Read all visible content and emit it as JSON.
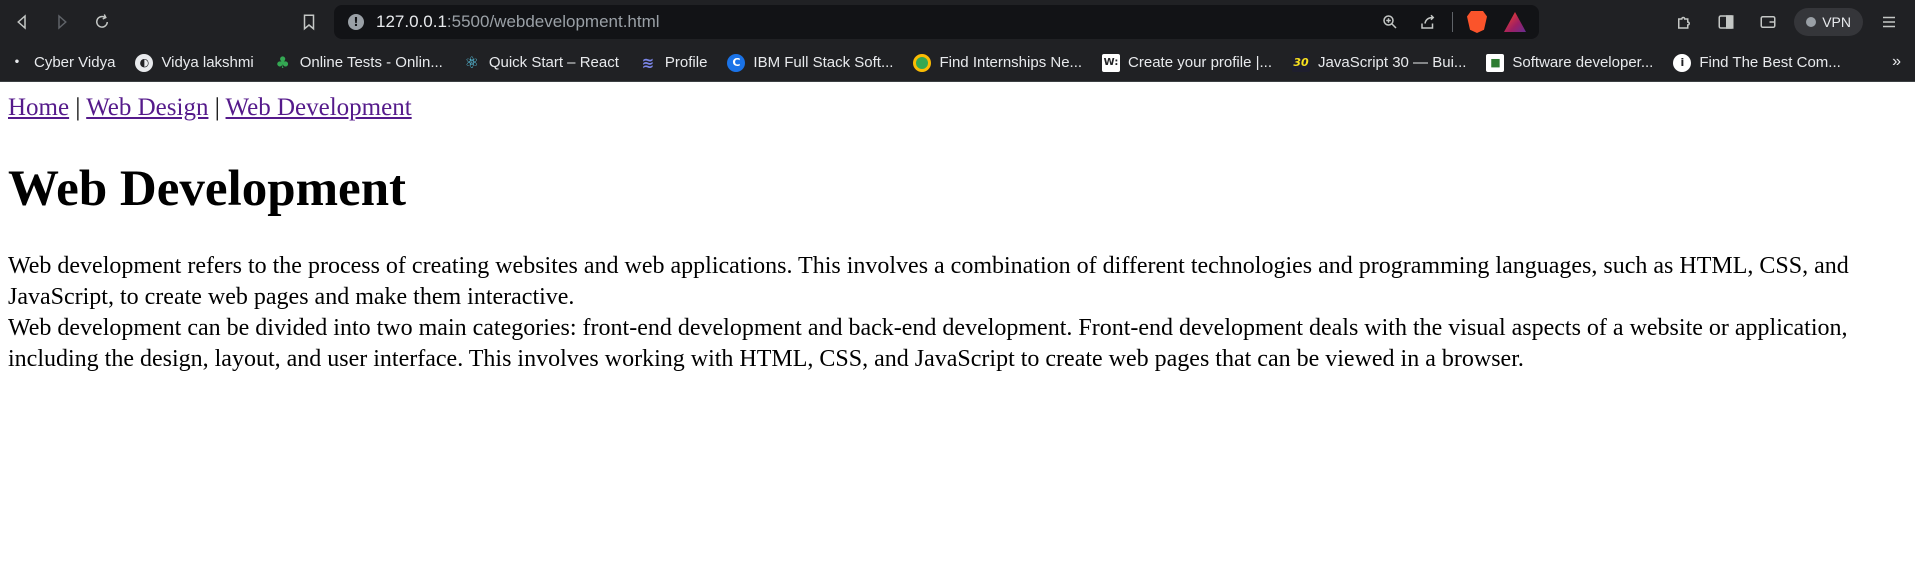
{
  "browser": {
    "url_host": "127.0.0.1",
    "url_path": ":5500/webdevelopment.html",
    "vpn_label": "VPN",
    "bookmarks": [
      {
        "label": "",
        "icon": "cyber-vidya-icon",
        "color": "#e8eaed"
      },
      {
        "label": "Cyber Vidya",
        "icon": "",
        "color": ""
      },
      {
        "label": "Vidya lakshmi",
        "icon": "globe-icon",
        "color": "#9aa0a6"
      },
      {
        "label": "Online Tests - Onlin...",
        "icon": "tree-icon",
        "color": "#34a853"
      },
      {
        "label": "Quick Start – React",
        "icon": "react-icon",
        "color": "#61dafb"
      },
      {
        "label": "Profile",
        "icon": "profile-icon",
        "color": "#5b6ee1"
      },
      {
        "label": "IBM Full Stack Soft...",
        "icon": "coursera-icon",
        "color": "#1a73e8"
      },
      {
        "label": "Find Internships Ne...",
        "icon": "internship-icon",
        "color": "#34a853"
      },
      {
        "label": "Create your profile |...",
        "icon": "w-icon",
        "color": "#ffffff"
      },
      {
        "label": "JavaScript 30 — Bui...",
        "icon": "js30-icon",
        "color": "#f7df1e"
      },
      {
        "label": "Software developer...",
        "icon": "job-icon",
        "color": "#2e7d32"
      },
      {
        "label": "Find The Best Com...",
        "icon": "info-icon",
        "color": "#ffffff"
      }
    ],
    "overflow_label": "»"
  },
  "page": {
    "nav": {
      "home": "Home",
      "sep": "|",
      "design": "Web Design",
      "development": "Web Development"
    },
    "title": "Web Development",
    "para1": "Web development refers to the process of creating websites and web applications. This involves a combination of different technologies and programming languages, such as HTML, CSS, and JavaScript, to create web pages and make them interactive.",
    "para2": "Web development can be divided into two main categories: front-end development and back-end development. Front-end development deals with the visual aspects of a website or application, including the design, layout, and user interface. This involves working with HTML, CSS, and JavaScript to create web pages that can be viewed in a browser."
  }
}
